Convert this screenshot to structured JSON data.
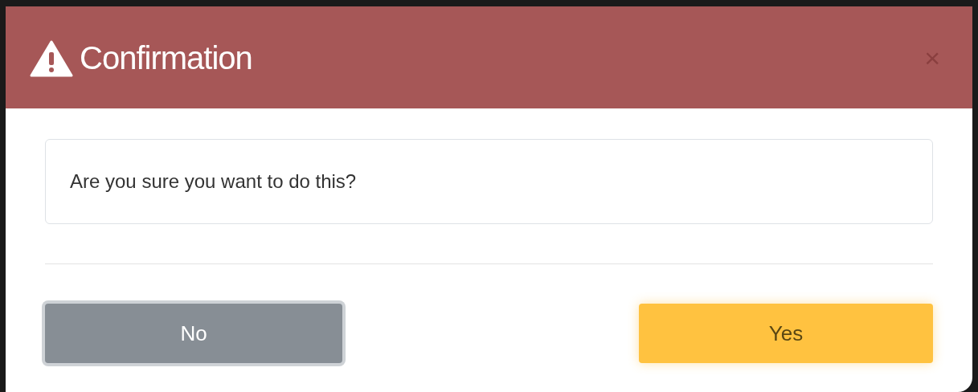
{
  "dialog": {
    "title": "Confirmation",
    "close": "×",
    "message": "Are you sure you want to do this?"
  },
  "buttons": [
    {
      "label": "No",
      "kind": "secondary",
      "focused": true
    },
    {
      "label": "Yes",
      "kind": "primary",
      "focused": false
    }
  ]
}
